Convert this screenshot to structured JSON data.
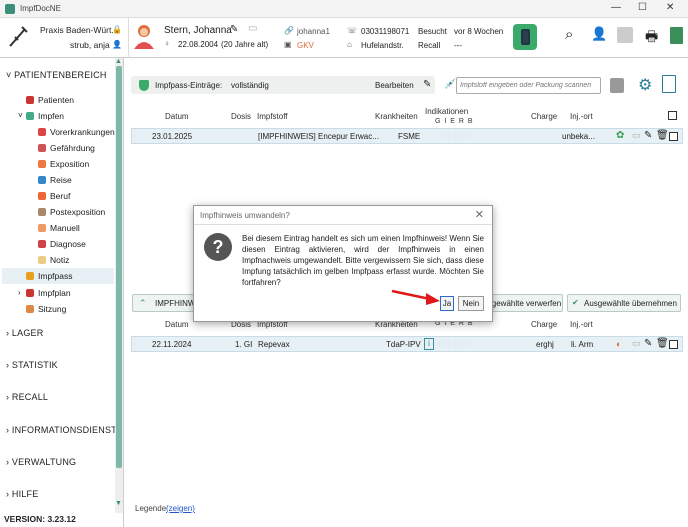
{
  "app": {
    "title": "ImpfDocNE"
  },
  "header": {
    "practice": "Praxis Baden-Würt...",
    "user": "strub, anja",
    "patient_name": "Stern, Johanna",
    "birthdate": "22.08.2004",
    "age": "(20 Jahre alt)",
    "username": "johanna1",
    "insurance": "GKV",
    "phone": "03031198071",
    "street": "Hufelandstr.",
    "visited_label": "Besucht",
    "visited_value": "vor 8 Wochen",
    "recall_label": "Recall",
    "recall_value": "---"
  },
  "sidebar": {
    "section_patient": "PATIENTENBEREICH",
    "patients": "Patienten",
    "impfen": "Impfen",
    "sub": [
      "Vorerkrankungen",
      "Gefährdung",
      "Exposition",
      "Reise",
      "Beruf",
      "Postexposition",
      "Manuell",
      "Diagnose",
      "Notiz"
    ],
    "impfpass": "Impfpass",
    "impfplan": "Impfplan",
    "sitzung": "Sitzung",
    "sections": [
      "LAGER",
      "STATISTIK",
      "RECALL",
      "INFORMATIONSDIENST",
      "VERWALTUNG",
      "HILFE"
    ],
    "version": "VERSION: 3.23.12"
  },
  "toolbar": {
    "entries_label": "Impfpass-Einträge:",
    "entries_value": "vollständig",
    "edit": "Bearbeiten",
    "search_placeholder": "Impfstoff eingeben oder Packung scannen"
  },
  "table": {
    "columns": {
      "date": "Datum",
      "dose": "Dosis",
      "vaccine": "Impfstoff",
      "disease": "Krankheiten",
      "indications": "Indikationen",
      "gierb": "G I E R B",
      "batch": "Charge",
      "site": "Inj.-ort"
    },
    "row1": {
      "date": "23.01.2025",
      "dose": "",
      "vaccine": "[IMPFHINWEIS] Encepur Erwac...",
      "disease": "FSME",
      "batch": "",
      "site": "unbeka..."
    },
    "row2": {
      "date": "22.11.2024",
      "dose": "1. GI",
      "vaccine": "Repevax",
      "disease": "TdaP-IPV",
      "batch": "erghj",
      "site": "li. Arm"
    }
  },
  "section2": {
    "collapse_label": "IMPFHINW",
    "discard": "Ausgewählte verwerfen",
    "accept": "Ausgewählte übernehmen"
  },
  "legend": {
    "label": "Legende",
    "link": "(zeigen)"
  },
  "dialog": {
    "title": "Impfhinweis umwandeln?",
    "message": "Bei diesem Eintrag handelt es sich um einen Impfhinweis! Wenn Sie diesen Eintrag aktivieren, wird der Impfhinweis in einen Impfnachweis umgewandelt. Bitte vergewissern Sie sich, dass diese Impfung tatsächlich im gelben Impfpass erfasst wurde. Möchten Sie fortfahren?",
    "yes": "Ja",
    "no": "Nein"
  }
}
